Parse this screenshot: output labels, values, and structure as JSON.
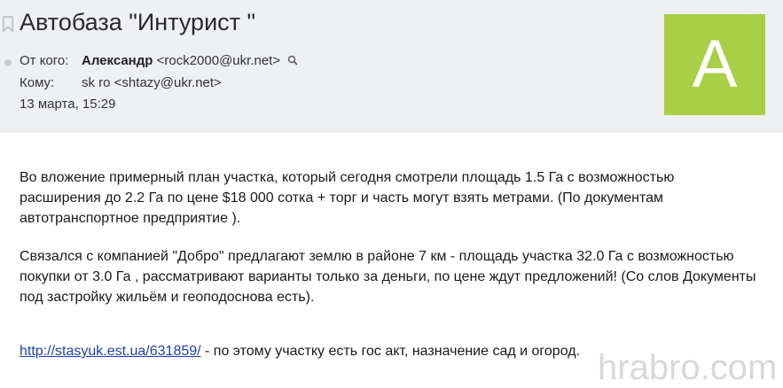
{
  "message": {
    "subject": "Автобаза \"Интурист \"",
    "from_label": "От кого:",
    "from_name": "Александр",
    "from_email": "<rock2000@ukr.net>",
    "to_label": "Кому:",
    "to_value": "sk ro <shtazy@ukr.net>",
    "date": "13 марта, 15:29",
    "avatar_letter": "A",
    "avatar_color": "#a8cf45"
  },
  "body": {
    "paragraph1_line1": "Во вложение примерный план участка, который сегодня  смотрели  площадь 1.5 Га  с возможностью",
    "paragraph1_line2": "расширения до 2.2 Га  по цене $18 000 сотка + торг  и  часть  могут взять метрами. (По документам",
    "paragraph1_line3": "автотранспортное предприятие ).",
    "paragraph2_line1": "Связался с компанией \"Добро\" предлагают  землю в районе 7 км - площадь участка 32.0 Га с возможностью",
    "paragraph2_line2": "покупки от 3.0 Га , рассматривают варианты только за деньги, по цене ждут предложений! (Со слов Документы",
    "paragraph2_line3": "под застройку жильём и геоподоснова есть).",
    "link_text": "http://stasyuk.est.ua/631859/",
    "link_suffix": " - по этому участку есть гос акт,  назначение сад и огород."
  },
  "watermark": "hrabro.com"
}
